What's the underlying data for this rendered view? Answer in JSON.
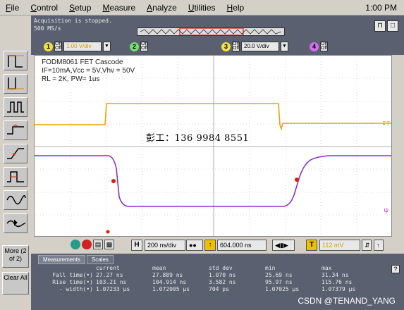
{
  "menu": {
    "items": [
      "File",
      "Control",
      "Setup",
      "Measure",
      "Analyze",
      "Utilities",
      "Help"
    ],
    "clock": "1:00 PM"
  },
  "status": {
    "line1": "Acquisition is stopped.",
    "line2": "500 MS/s"
  },
  "channels": [
    {
      "num": "1",
      "value": "1.00 V/div",
      "color": "#f0e040"
    },
    {
      "num": "2",
      "value": "",
      "color": "#70e070"
    },
    {
      "num": "3",
      "value": "20.0 V/div",
      "color": "#f0e040"
    },
    {
      "num": "4",
      "value": "",
      "color": "#d070f0"
    }
  ],
  "annotation": {
    "line1": "FODM8061 FET Cascode",
    "line2": "IF=10mA,Vcc = 5V,Vhv = 50V",
    "line3": "RL = 2K, PW= 1us"
  },
  "watermark": "彭工：136 9984 8551",
  "left_buttons": {
    "more_label": "More (2 of 2)",
    "clear_label": "Clear All"
  },
  "timebase": {
    "h_label": "H",
    "h_value": "200 ns/div",
    "delay_value": "604.000 ns",
    "trigger_label": "T",
    "trigger_value": "112 mV"
  },
  "measurements": {
    "tabs": [
      "Measurements",
      "Scales"
    ],
    "headers": [
      "current",
      "mean",
      "std dev",
      "min",
      "max"
    ],
    "rows": [
      {
        "label": "Fall time(•)",
        "values": [
          "27.27 ns",
          "27.889 ns",
          "1.070 ns",
          "25.69 ns",
          "31.34 ns"
        ]
      },
      {
        "label": "Rise time(•)",
        "values": [
          "103.21 ns",
          "104.914 ns",
          "3.582 ns",
          "95.97 ns",
          "115.76 ns"
        ]
      },
      {
        "label": "- width(•)",
        "values": [
          "1.07233 µs",
          "1.072005 µs",
          "704 ps",
          "1.07025 µs",
          "1.07379 µs"
        ]
      }
    ],
    "help": "?"
  },
  "footer_watermark": "CSDN @TENAND_YANG",
  "colors": {
    "yellow_trace": "#e8a800",
    "purple_trace": "#8a30c8",
    "marker": "#e02000"
  }
}
